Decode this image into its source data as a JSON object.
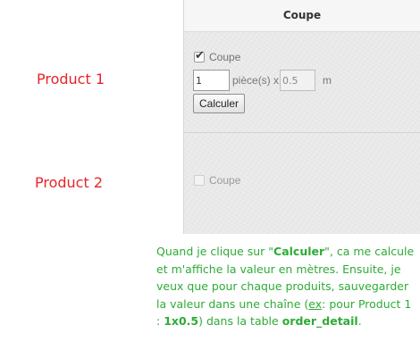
{
  "products": [
    {
      "label": "Product 1"
    },
    {
      "label": "Product 2"
    }
  ],
  "panel": {
    "header_title": "Coupe",
    "row1": {
      "checkbox_label": "Coupe",
      "checked": true,
      "quantity_value": "1",
      "quantity_unit": "pièce(s) x",
      "length_value": "0.5",
      "length_unit": "m",
      "calculate_button": "Calculer"
    },
    "row2": {
      "checkbox_label": "Coupe",
      "checked": false
    }
  },
  "note": {
    "part1": "Quand je clique sur \"",
    "button_ref": "Calculer",
    "part2": "\", ca me calcule et m'affiche la valeur en mètres. Ensuite, je veux que pour chaque produits, sauvegarder la valeur dans une chaîne (",
    "ex_label": "ex",
    "part3": ": pour Product 1 : ",
    "example_value": "1x0.5",
    "part4": ") dans la table ",
    "table_name": "order_detail",
    "part5": "."
  },
  "colors": {
    "product_label": "#e8232a",
    "note_text": "#2eab36"
  },
  "icons": {
    "checkbox_checked": "check-icon"
  }
}
